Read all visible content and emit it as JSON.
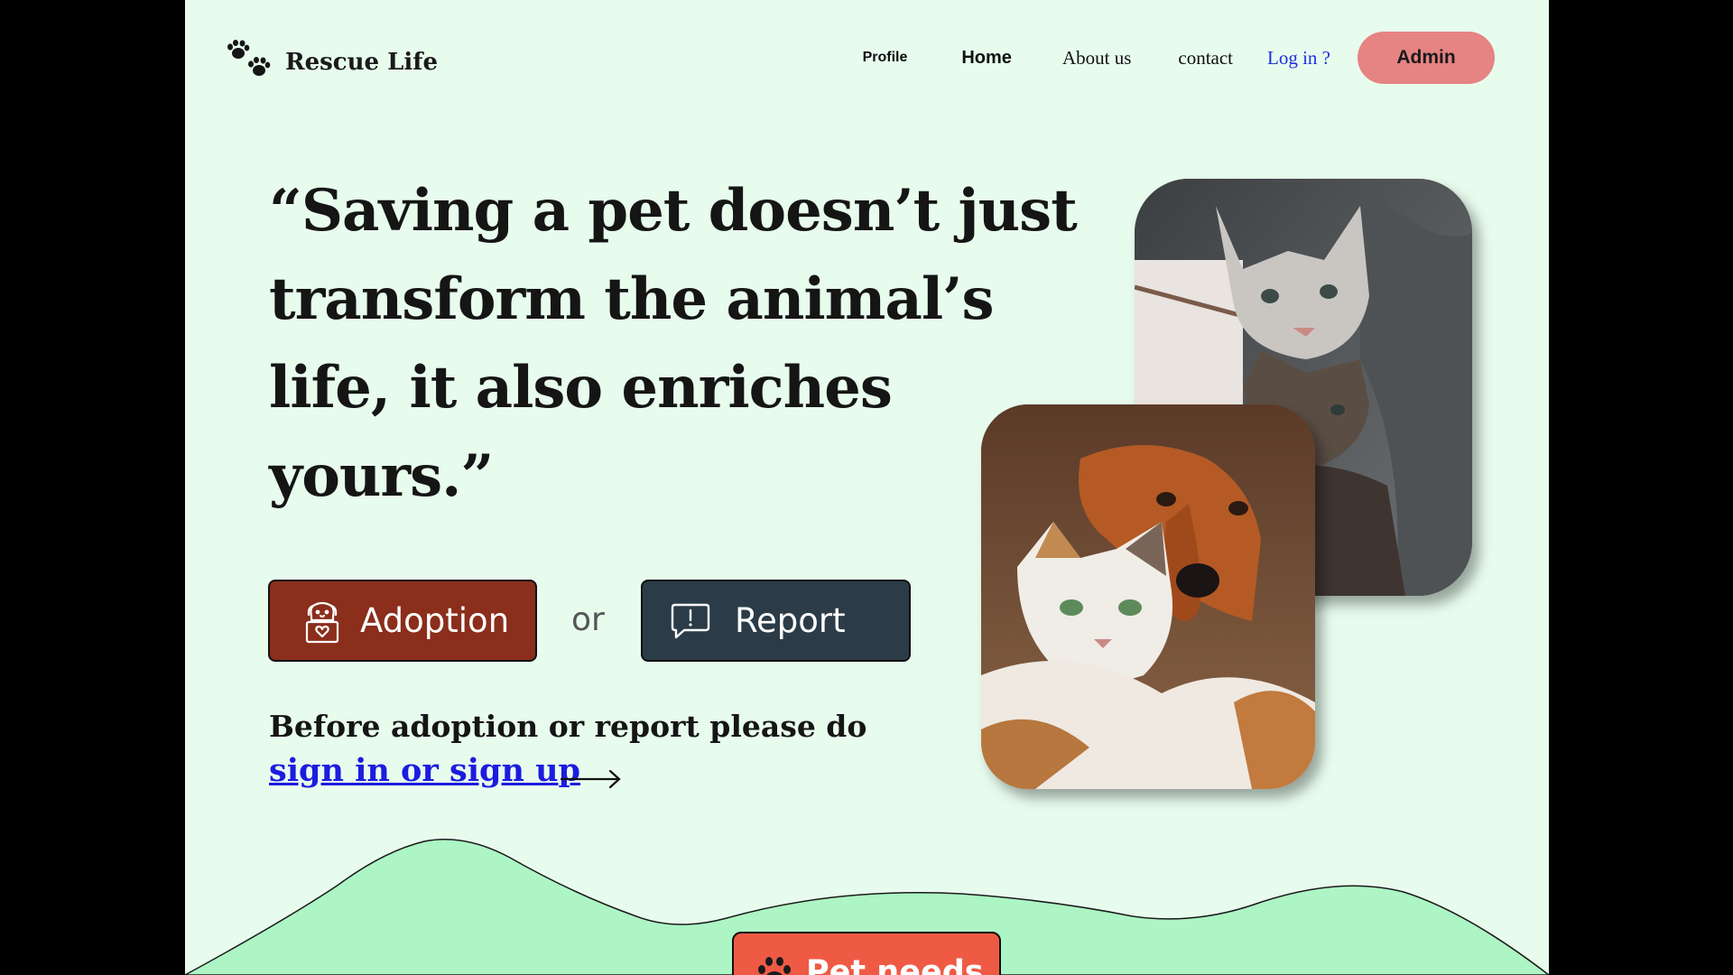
{
  "brand": {
    "name": "Rescue Life",
    "icon": "paw-prints-icon"
  },
  "nav": {
    "profile": "Profile",
    "home": "Home",
    "about": "About us",
    "contact": "contact",
    "login": "Log in ?",
    "admin": "Admin"
  },
  "hero": {
    "quote": "“Saving a pet doesn’t just transform the animal’s life, it also enriches yours.”",
    "adoption_label": "Adoption",
    "adoption_icon": "dog-heart-box-icon",
    "or_text": "or",
    "report_label": "Report",
    "report_icon": "alert-message-icon",
    "note": "Before adoption or report please do",
    "signin_link": "sign in or sign up"
  },
  "footer": {
    "pet_needs_label": "Pet needs",
    "pet_needs_icon": "paw-icon"
  },
  "colors": {
    "background": "#e8fcee",
    "admin_button": "#e68383",
    "adoption_button": "#8b2e1c",
    "report_button": "#2b3c48",
    "link": "#1c1ce0",
    "hill": "#adf5c4",
    "pet_needs_button": "#ef5a45"
  }
}
